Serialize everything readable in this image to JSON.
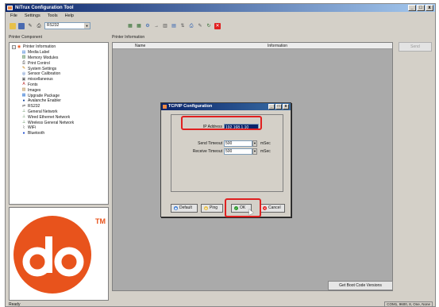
{
  "window": {
    "title": "NiTrux Configuration Tool",
    "minimize": "_",
    "maximize": "□",
    "close": "x"
  },
  "menu": [
    {
      "label": "File"
    },
    {
      "label": "Settings"
    },
    {
      "label": "Tools"
    },
    {
      "label": "Help"
    }
  ],
  "toolbar": {
    "port_value": "RS232",
    "left_icons": [
      "open-icon",
      "save-icon",
      "edit-icon",
      "print-icon"
    ],
    "right_icons": [
      "grid-icon",
      "grid-icon",
      "settings-icon",
      "arrow-icon",
      "bar-icon",
      "chart-icon",
      "transfer-icon",
      "printer-icon",
      "pencil-icon",
      "refresh-icon",
      "stop-icon"
    ]
  },
  "panels": {
    "left_label": "Printer Component",
    "right_label": "Printer Information"
  },
  "tree": {
    "root": "Printer Information",
    "items": [
      {
        "label": "Media Label",
        "icon": "label-icon",
        "color": "#3a7bd5"
      },
      {
        "label": "Memory Modules",
        "icon": "memory-icon",
        "color": "#2a6a2a"
      },
      {
        "label": "Print Control",
        "icon": "print-icon",
        "color": "#555555"
      },
      {
        "label": "System Settings",
        "icon": "wrench-icon",
        "color": "#c07a00"
      },
      {
        "label": "Sensor Calibration",
        "icon": "sensor-icon",
        "color": "#2a5db0"
      },
      {
        "label": "miscellaneous",
        "icon": "misc-icon",
        "color": "#666666"
      },
      {
        "label": "Fonts",
        "icon": "font-icon",
        "color": "#c03030"
      },
      {
        "label": "Images",
        "icon": "image-icon",
        "color": "#b0803a"
      },
      {
        "label": "Upgrade Package",
        "icon": "package-icon",
        "color": "#3a7bd5"
      },
      {
        "label": "Avalanche Enabler",
        "icon": "avalanche-icon",
        "color": "#1a4aa0"
      },
      {
        "label": "RS232",
        "icon": "serial-icon",
        "color": "#555555"
      },
      {
        "label": "General Network",
        "icon": "network-icon",
        "color": "#2a6a2a"
      },
      {
        "label": "Wired Ethernet Network",
        "icon": "ethernet-icon",
        "color": "#2a6a2a"
      },
      {
        "label": "Wireless General Network",
        "icon": "wireless-icon",
        "color": "#2a6a2a"
      },
      {
        "label": "WiFi",
        "icon": "wifi-icon",
        "color": "#333333"
      },
      {
        "label": "Bluetooth",
        "icon": "bluetooth-icon",
        "color": "#1a4ad0"
      }
    ]
  },
  "logo": {
    "tm": "TM",
    "brand_color": "#e8531c"
  },
  "info_table": {
    "col_name": "Name",
    "col_info": "Information"
  },
  "buttons": {
    "send": "Send",
    "boot_versions": "Get Boot Code Versions"
  },
  "status": {
    "left": "Ready",
    "right": "COM1, 9600, 8, One, None"
  },
  "dialog": {
    "title": "TCP/IP Configuration",
    "ip_label": "IP Address",
    "ip_value": "192.168.1.10",
    "send_timeout_label": "Send Timeout",
    "send_timeout_value": "500",
    "receive_timeout_label": "Receive Timeout",
    "receive_timeout_value": "500",
    "unit": "mSec",
    "default_btn": "Default",
    "ping_btn": "Ping",
    "ok_btn": "OK",
    "cancel_btn": "Cancel"
  },
  "highlight_color": "#e02020"
}
